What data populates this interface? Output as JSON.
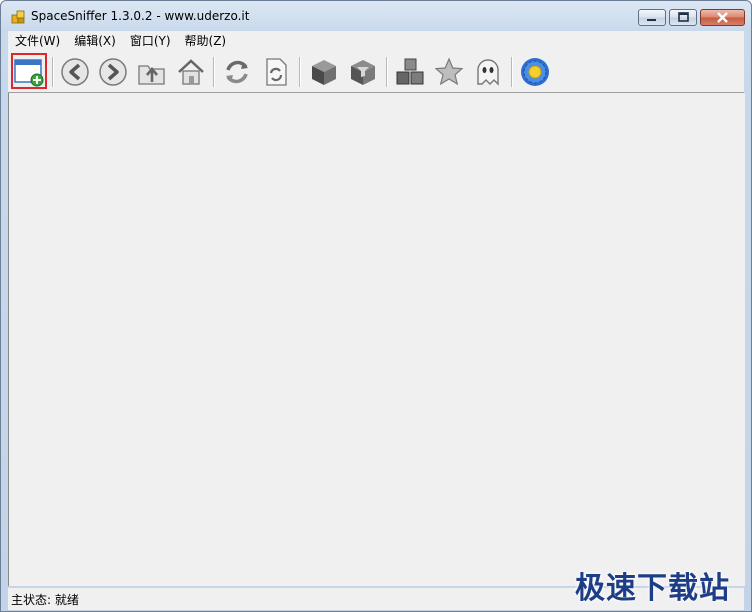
{
  "window": {
    "title": "SpaceSniffer 1.3.0.2 - www.uderzo.it"
  },
  "menu": {
    "items": [
      {
        "label": "文件(W)"
      },
      {
        "label": "编辑(X)"
      },
      {
        "label": "窗口(Y)"
      },
      {
        "label": "帮助(Z)"
      }
    ]
  },
  "toolbar": {
    "buttons": [
      {
        "icon": "new-window-icon",
        "highlighted": true
      },
      {
        "icon": "back-arrow-icon"
      },
      {
        "icon": "forward-arrow-icon"
      },
      {
        "icon": "folder-up-icon"
      },
      {
        "icon": "home-icon"
      },
      {
        "icon": "refresh-icon"
      },
      {
        "icon": "refresh-document-icon"
      },
      {
        "icon": "cube-dark-icon"
      },
      {
        "icon": "cube-filter-icon"
      },
      {
        "icon": "blocks-icon"
      },
      {
        "icon": "star-icon"
      },
      {
        "icon": "ghost-icon"
      },
      {
        "icon": "gear-flower-icon"
      }
    ],
    "highlight_color": "#e0262d"
  },
  "status": {
    "text": "主状态: 就绪"
  },
  "watermark": {
    "text": "极速下载站"
  }
}
